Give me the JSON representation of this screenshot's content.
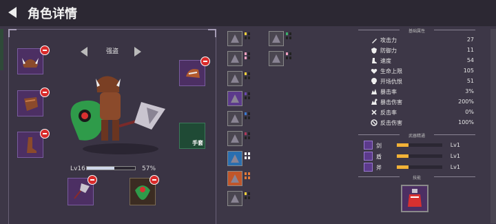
{
  "header": {
    "title": "角色详情"
  },
  "hero": {
    "name": "强盗",
    "level": "Lv16",
    "xp_percent": "57%",
    "xp_fraction": 0.57
  },
  "equipment": {
    "glove_label": "手套"
  },
  "stats": {
    "section_title": "基础属性",
    "rows": [
      {
        "label": "攻击力",
        "value": "27",
        "icon": "sword-icon"
      },
      {
        "label": "防御力",
        "value": "11",
        "icon": "shield-icon"
      },
      {
        "label": "速度",
        "value": "54",
        "icon": "boot-icon"
      },
      {
        "label": "生命上限",
        "value": "105",
        "icon": "heart-icon"
      },
      {
        "label": "开场仇恨",
        "value": "51",
        "icon": "skull-icon"
      },
      {
        "label": "暴击率",
        "value": "3%",
        "icon": "crit-icon"
      },
      {
        "label": "暴击伤害",
        "value": "200%",
        "icon": "crit-damage-icon"
      },
      {
        "label": "反击率",
        "value": "0%",
        "icon": "counter-icon"
      },
      {
        "label": "反击伤害",
        "value": "100%",
        "icon": "counter-damage-icon"
      }
    ]
  },
  "weapon_skill": {
    "section_title": "武器精通",
    "rows": [
      {
        "label": "剑",
        "level": "Lv1",
        "fraction": 0.25
      },
      {
        "label": "盾",
        "level": "Lv1",
        "fraction": 0.25
      },
      {
        "label": "斧",
        "level": "Lv1",
        "fraction": 0.25
      }
    ]
  },
  "skills": {
    "section_title": "技能"
  },
  "colors": {
    "accent": "#f2b237",
    "remove": "#d82b2b",
    "panel": "#3a3444",
    "slot": "#4c2f63",
    "glove": "#1f4a35"
  }
}
